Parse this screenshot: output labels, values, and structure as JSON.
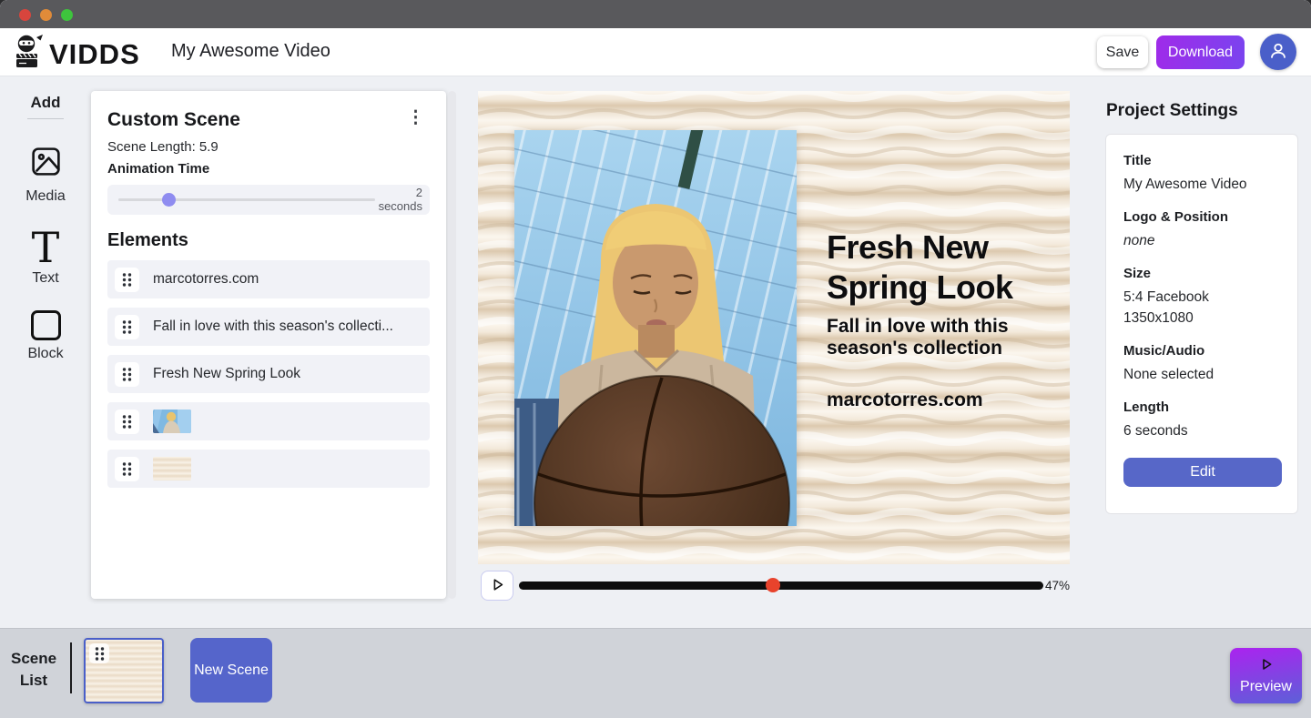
{
  "header": {
    "logo_text": "VIDDS",
    "project_title": "My Awesome Video",
    "save_label": "Save",
    "download_label": "Download"
  },
  "sidebar": {
    "add_label": "Add",
    "items": [
      {
        "label": "Media",
        "icon": "image-icon"
      },
      {
        "label": "Text",
        "icon": "text-icon"
      },
      {
        "label": "Block",
        "icon": "block-icon"
      }
    ]
  },
  "scene_panel": {
    "title": "Custom Scene",
    "scene_length": "Scene Length: 5.9",
    "animation_time_label": "Animation Time",
    "slider_value": "2",
    "slider_unit": "seconds",
    "elements_label": "Elements",
    "elements": [
      {
        "type": "text",
        "label": "marcotorres.com"
      },
      {
        "type": "text",
        "label": "Fall in love with this season's collecti..."
      },
      {
        "type": "text",
        "label": "Fresh New Spring Look"
      },
      {
        "type": "image",
        "content": "photo-thumbnail"
      },
      {
        "type": "image",
        "content": "texture-thumbnail"
      }
    ]
  },
  "preview": {
    "headline": "Fresh New Spring Look",
    "subheadline": "Fall in love with this season's collection",
    "website": "marcotorres.com",
    "progress_percent": "47%"
  },
  "project_settings": {
    "heading": "Project Settings",
    "fields": [
      {
        "label": "Title",
        "value": "My Awesome Video"
      },
      {
        "label": "Logo & Position",
        "value": "none"
      },
      {
        "label": "Size",
        "value": "5:4 Facebook",
        "value2": "1350x1080"
      },
      {
        "label": "Music/Audio",
        "value": "None selected"
      },
      {
        "label": "Length",
        "value": "6 seconds"
      }
    ],
    "edit_label": "Edit"
  },
  "footer": {
    "scene_list_label": "Scene List",
    "new_scene_label": "New Scene",
    "preview_label": "Preview"
  },
  "icons": {
    "kebab": "⋮"
  },
  "colors": {
    "accent_indigo": "#5767c8",
    "download_purple": "#9f2be9",
    "preview_gradient_top": "#a726ee",
    "preview_gradient_bottom": "#5d60d8",
    "slider_thumb": "#8f8cf0",
    "seek_dot_red": "#e8432c",
    "titlebar_gray": "#59595c",
    "footer_gray": "#d0d3d9"
  }
}
